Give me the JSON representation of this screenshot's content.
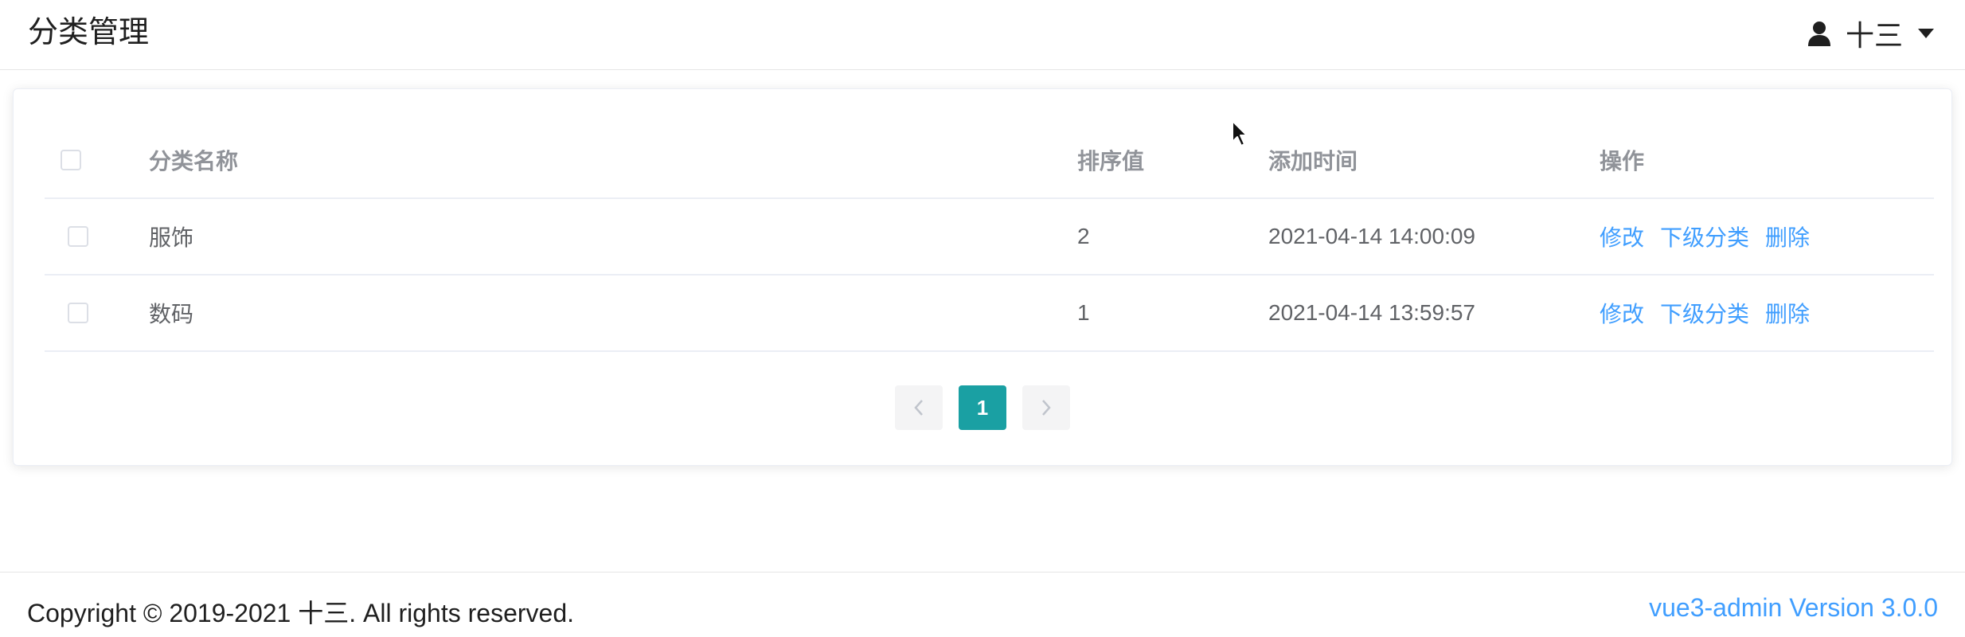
{
  "header": {
    "title": "分类管理",
    "user": {
      "icon": "user-icon",
      "name": "十三",
      "caret_icon": "caret-down-icon"
    }
  },
  "table": {
    "columns": {
      "name": "分类名称",
      "sort": "排序值",
      "time": "添加时间",
      "ops": "操作"
    },
    "rows": [
      {
        "name": "服饰",
        "sort": "2",
        "time": "2021-04-14 14:00:09",
        "checked": false
      },
      {
        "name": "数码",
        "sort": "1",
        "time": "2021-04-14 13:59:57",
        "checked": false
      }
    ],
    "actions": {
      "edit": "修改",
      "sub": "下级分类",
      "delete": "删除"
    }
  },
  "pagination": {
    "prev_icon": "chevron-left-icon",
    "current_page": "1",
    "next_icon": "chevron-right-icon"
  },
  "footer": {
    "copyright": "Copyright © 2019-2021 十三. All rights reserved.",
    "version": "vue3-admin Version 3.0.0"
  },
  "colors": {
    "accent": "#409eff",
    "pagination_active": "#1aa0a3",
    "header_text": "#909399"
  }
}
